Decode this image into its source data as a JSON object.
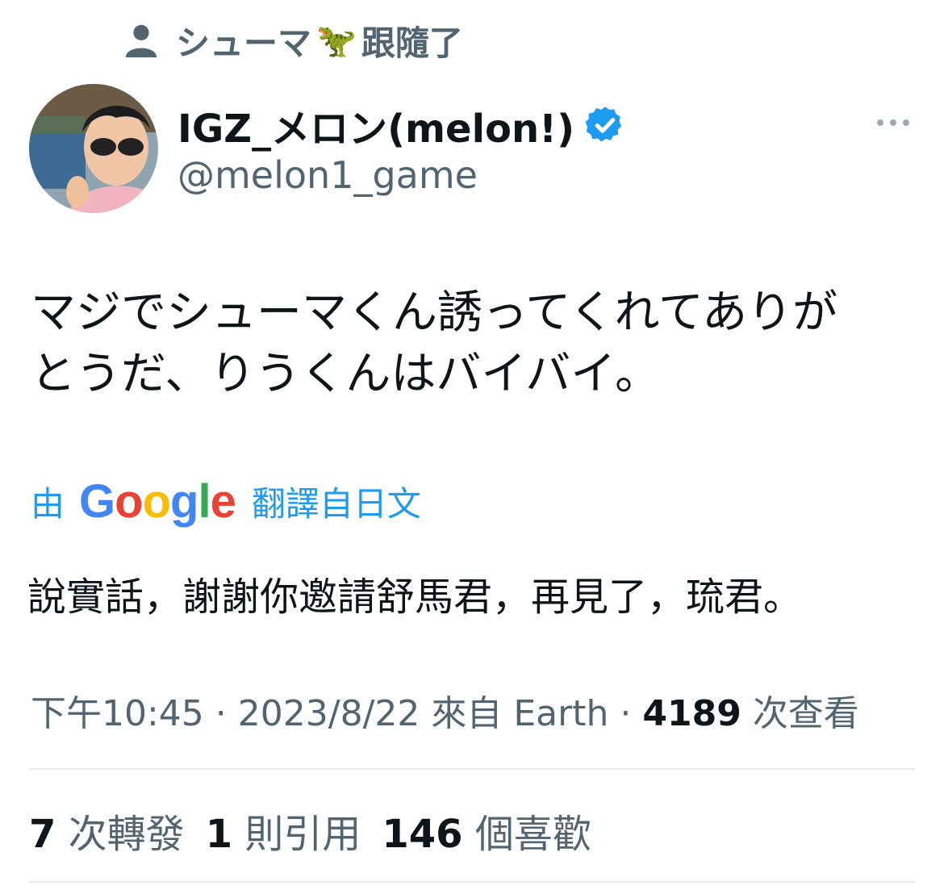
{
  "social_context": {
    "user_name": "シューマ",
    "dino_emoji": "🦖",
    "action": "跟隨了"
  },
  "author": {
    "display_name": "IGZ_メロン(melon!)",
    "handle": "@melon1_game",
    "verified_icon": "verified-badge-icon",
    "verified_color": "#1d9bf0"
  },
  "tweet": {
    "text_line1": "マジでシューマくん誘ってくれてありが",
    "text_line2": "とうだ、りうくんはバイバイ。"
  },
  "translation": {
    "prefix": "由",
    "google_letters": [
      "G",
      "o",
      "o",
      "g",
      "l",
      "e"
    ],
    "suffix": "翻譯自日文",
    "text": "說實話，謝謝你邀請舒馬君，再見了，琉君。"
  },
  "meta": {
    "time": "下午10:45",
    "separator": " · ",
    "date": "2023/8/22",
    "source": "來自 Earth",
    "views_count": "4189",
    "views_label": "次查看"
  },
  "stats": {
    "retweets_count": "7",
    "retweets_label": "次轉發",
    "quotes_count": "1",
    "quotes_label": "則引用",
    "likes_count": "146",
    "likes_label": "個喜歡"
  },
  "colors": {
    "text_primary": "#0f1419",
    "text_secondary": "#536471",
    "link": "#1d9bf0",
    "divider": "#e7ebee"
  }
}
